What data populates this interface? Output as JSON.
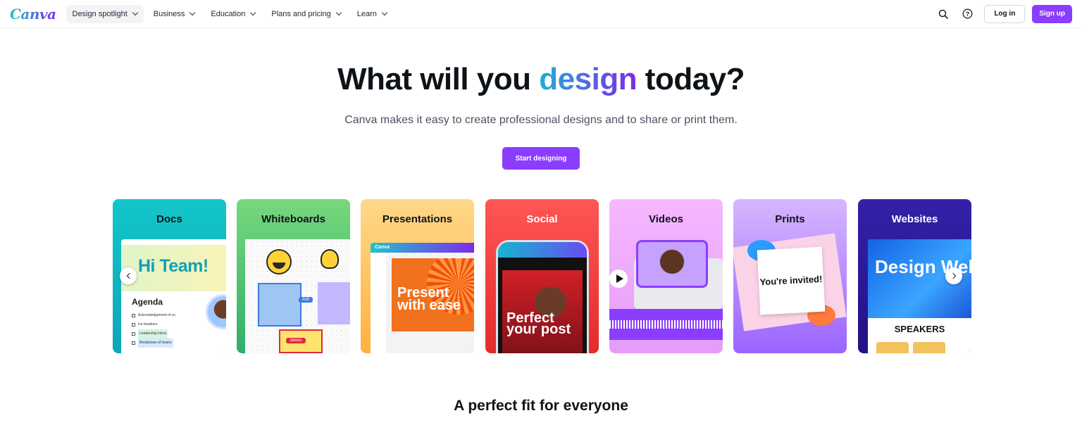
{
  "nav": {
    "logo": "Canva",
    "items": [
      {
        "label": "Design spotlight"
      },
      {
        "label": "Business"
      },
      {
        "label": "Education"
      },
      {
        "label": "Plans and pricing"
      },
      {
        "label": "Learn"
      }
    ],
    "login_label": "Log in",
    "signup_label": "Sign up",
    "icons": [
      "search-icon",
      "help-icon"
    ]
  },
  "hero": {
    "title_pre": "What will you ",
    "title_accent": "design",
    "title_post": " today?",
    "subtitle": "Canva makes it easy to create professional designs and to share or print them.",
    "cta_label": "Start designing"
  },
  "cards": [
    {
      "title": "Docs",
      "hi": "Hi Team!",
      "agenda": "Agenda",
      "items": [
        "Acknowledgement of co",
        "Ice breakers",
        "Leadership intros",
        "Breakdown of teams"
      ]
    },
    {
      "title": "Whiteboards",
      "tag1": "Ash",
      "tag2": "James"
    },
    {
      "title": "Presentations",
      "app": "Canva",
      "slide_text": "Present with ease"
    },
    {
      "title": "Social",
      "post_text": "Perfect your post"
    },
    {
      "title": "Videos"
    },
    {
      "title": "Prints",
      "card_text": "You're invited!"
    },
    {
      "title": "Websites",
      "hero_text": "Design Websit",
      "speakers": "SPEAKERS"
    }
  ],
  "section": {
    "title": "A perfect fit for everyone"
  },
  "colors": {
    "brand_purple": "#8b3dff",
    "accent_teal": "#1cb2d6"
  }
}
